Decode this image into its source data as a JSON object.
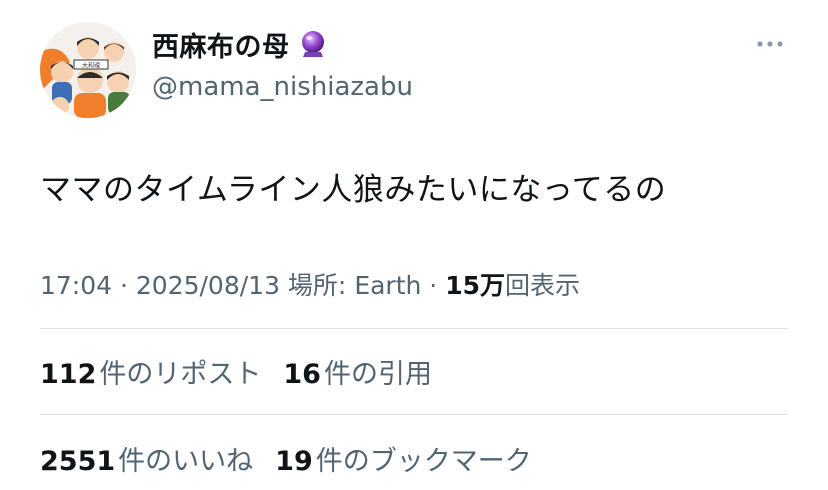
{
  "author": {
    "display_name": "西麻布の母",
    "handle": "@mama_nishiazabu",
    "avatar_icon": "cartoon-family-avatar",
    "badge_icon": "crystal-ball-icon"
  },
  "tweet": {
    "text": "ママのタイムライン人狼みたいになってるの"
  },
  "meta": {
    "time": "17:04",
    "separator1": " · ",
    "date": "2025/08/13",
    "location_prefix": " 場所: ",
    "location": "Earth",
    "separator2": " · ",
    "views_count": "15万",
    "views_label": "回表示"
  },
  "stats": {
    "reposts_count": "112",
    "reposts_label": "件のリポスト",
    "quotes_count": "16",
    "quotes_label": "件の引用",
    "likes_count": "2551",
    "likes_label": "件のいいね",
    "bookmarks_count": "19",
    "bookmarks_label": "件のブックマーク"
  },
  "colors": {
    "text_primary": "#0f1419",
    "text_secondary": "#536471",
    "divider": "#dfe3e6"
  }
}
